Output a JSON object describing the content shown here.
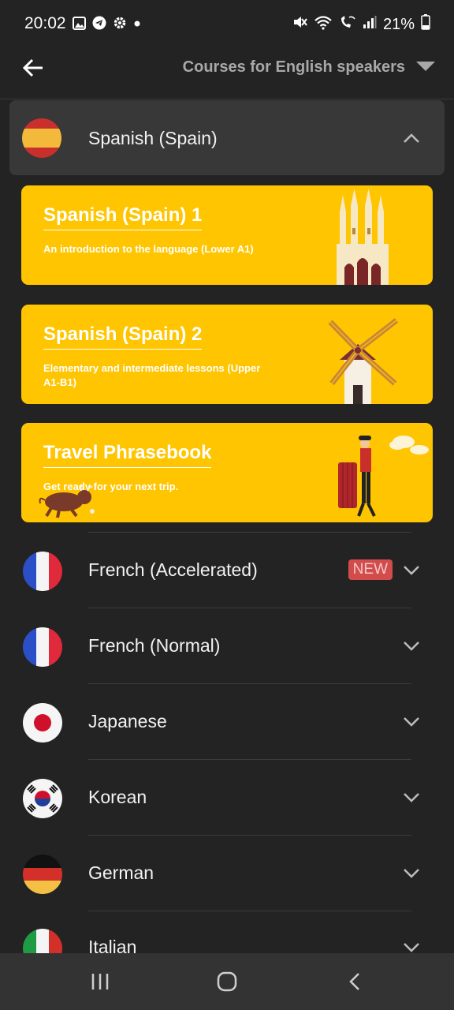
{
  "status": {
    "time": "20:02",
    "battery": "21%"
  },
  "appbar": {
    "dropdown_label": "Courses for English speakers"
  },
  "expanded_course": {
    "name": "Spanish (Spain)"
  },
  "cards": [
    {
      "title": "Spanish (Spain) 1",
      "desc": "An introduction to the language (Lower A1)"
    },
    {
      "title": "Spanish (Spain) 2",
      "desc": "Elementary and intermediate lessons (Upper A1-B1)"
    },
    {
      "title": "Travel Phrasebook",
      "desc": "Get ready for your next trip."
    }
  ],
  "courses": [
    {
      "name": "French (Accelerated)",
      "badge": "NEW"
    },
    {
      "name": "French (Normal)"
    },
    {
      "name": "Japanese"
    },
    {
      "name": "Korean"
    },
    {
      "name": "German"
    },
    {
      "name": "Italian"
    }
  ],
  "colors": {
    "background": "#232323",
    "card": "#fec500",
    "badge": "#d34c4c"
  }
}
